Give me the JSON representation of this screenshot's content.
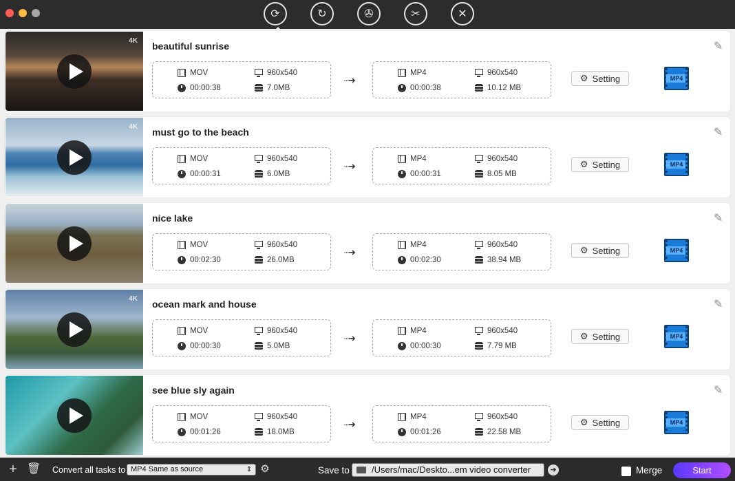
{
  "window": {
    "controls": [
      "close",
      "minimize",
      "maximize"
    ]
  },
  "tabs": [
    {
      "name": "convert-tab",
      "icon": "convert-icon",
      "active": true
    },
    {
      "name": "rotate-tab",
      "icon": "rotate-icon",
      "active": false
    },
    {
      "name": "media-tab",
      "icon": "film-reel-icon",
      "active": false
    },
    {
      "name": "edit-tab",
      "icon": "film-edit-icon",
      "active": false
    },
    {
      "name": "tools-tab",
      "icon": "tools-icon",
      "active": false
    }
  ],
  "rows": [
    {
      "title": "beautiful sunrise",
      "badge": "4K",
      "src": {
        "format": "MOV",
        "resolution": "960x540",
        "duration": "00:00:38",
        "size": "7.0MB"
      },
      "dst": {
        "format": "MP4",
        "resolution": "960x540",
        "duration": "00:00:38",
        "size": "10.12 MB"
      },
      "setting": "Setting",
      "target_label": "MP4"
    },
    {
      "title": "must go to the beach",
      "badge": "4K",
      "src": {
        "format": "MOV",
        "resolution": "960x540",
        "duration": "00:00:31",
        "size": "6.0MB"
      },
      "dst": {
        "format": "MP4",
        "resolution": "960x540",
        "duration": "00:00:31",
        "size": "8.05 MB"
      },
      "setting": "Setting",
      "target_label": "MP4"
    },
    {
      "title": "nice lake",
      "badge": "",
      "src": {
        "format": "MOV",
        "resolution": "960x540",
        "duration": "00:02:30",
        "size": "26.0MB"
      },
      "dst": {
        "format": "MP4",
        "resolution": "960x540",
        "duration": "00:02:30",
        "size": "38.94 MB"
      },
      "setting": "Setting",
      "target_label": "MP4"
    },
    {
      "title": "ocean mark and house",
      "badge": "4K",
      "src": {
        "format": "MOV",
        "resolution": "960x540",
        "duration": "00:00:30",
        "size": "5.0MB"
      },
      "dst": {
        "format": "MP4",
        "resolution": "960x540",
        "duration": "00:00:30",
        "size": "7.79 MB"
      },
      "setting": "Setting",
      "target_label": "MP4"
    },
    {
      "title": "see blue sly again",
      "badge": "",
      "src": {
        "format": "MOV",
        "resolution": "960x540",
        "duration": "00:01:26",
        "size": "18.0MB"
      },
      "dst": {
        "format": "MP4",
        "resolution": "960x540",
        "duration": "00:01:26",
        "size": "22.58 MB"
      },
      "setting": "Setting",
      "target_label": "MP4"
    }
  ],
  "bottom": {
    "convert_all_label": "Convert all tasks to",
    "convert_all_value": "MP4 Same as source",
    "save_to_label": "Save to",
    "save_path": "/Users/mac/Deskto...em video converter",
    "merge_label": "Merge",
    "start_label": "Start"
  },
  "colors": {
    "accent_start": "#5b39ff",
    "accent_end": "#b14cff",
    "titlebar": "#2c2c2c",
    "list_bg": "#f0f0f0"
  }
}
